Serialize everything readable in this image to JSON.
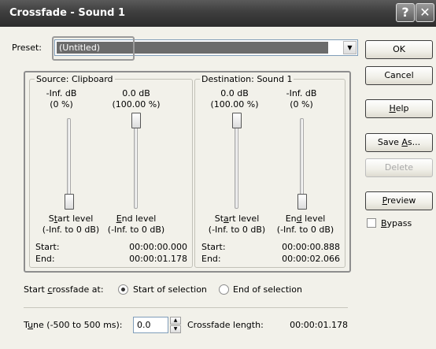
{
  "window": {
    "title": "Crossfade - Sound 1",
    "help_glyph": "?",
    "close_glyph": "✕"
  },
  "preset": {
    "label": "Preset:",
    "value": "(Untitled)"
  },
  "source": {
    "legend": "Source: Clipboard",
    "start_db": "-Inf. dB",
    "start_pct": "(0 %)",
    "end_db": "0.0 dB",
    "end_pct": "(100.00 %)",
    "start_label": {
      "pre": "S",
      "acc": "t",
      "post": "art level"
    },
    "end_label": {
      "pre": "",
      "acc": "E",
      "post": "nd level"
    },
    "start_range": "(-Inf. to 0 dB)",
    "end_range": "(-Inf. to 0 dB)",
    "start_key": "Start:",
    "start_time": "00:00:00.000",
    "end_key": "End:",
    "end_time": "00:00:01.178",
    "start_level_value": 0.0,
    "end_level_value": 1.0
  },
  "destination": {
    "legend": "Destination: Sound 1",
    "start_db": "0.0 dB",
    "start_pct": "(100.00 %)",
    "end_db": "-Inf. dB",
    "end_pct": "(0 %)",
    "start_label": {
      "pre": "St",
      "acc": "a",
      "post": "rt level"
    },
    "end_label": {
      "pre": "En",
      "acc": "d",
      "post": " level"
    },
    "start_range": "(-Inf. to 0 dB)",
    "end_range": "(-Inf. to 0 dB)",
    "start_key": "Start:",
    "start_time": "00:00:00.888",
    "end_key": "End:",
    "end_time": "00:00:02.066",
    "start_level_value": 1.0,
    "end_level_value": 0.0
  },
  "crossfade_at": {
    "label": {
      "pre": "Start ",
      "acc": "c",
      "post": "rossfade at:"
    },
    "options": [
      {
        "label": "Start of selection",
        "selected": true
      },
      {
        "label": "End of selection",
        "selected": false
      }
    ]
  },
  "tune": {
    "label": {
      "pre": "T",
      "acc": "u",
      "post": "ne (-500 to 500 ms):"
    },
    "value": "0.0"
  },
  "crossfade_length": {
    "label": "Crossfade length:",
    "value": "00:00:01.178"
  },
  "buttons": {
    "ok": "OK",
    "cancel": "Cancel",
    "help": {
      "pre": "",
      "acc": "H",
      "post": "elp"
    },
    "save_as": {
      "pre": "Save ",
      "acc": "A",
      "post": "s..."
    },
    "delete": "Delete",
    "preview": {
      "pre": "",
      "acc": "P",
      "post": "review"
    }
  },
  "bypass": {
    "label": {
      "pre": "",
      "acc": "B",
      "post": "ypass"
    },
    "checked": false
  },
  "colors": {
    "titlebar": "#3e3e3e",
    "face": "#f2f1ea",
    "selection": "#6b6b6b"
  }
}
